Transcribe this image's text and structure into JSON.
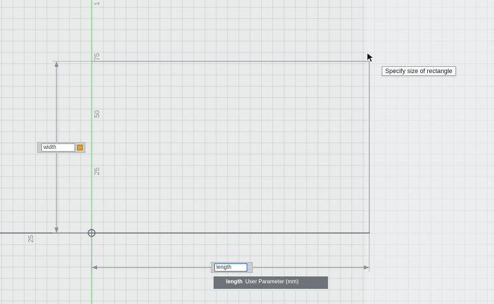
{
  "sketch": {
    "tooltip": "Specify size of rectangle",
    "axis_labels": {
      "y_75": "75",
      "y_50": "50",
      "y_25": "25",
      "x_25": "25",
      "y_top": "1"
    },
    "width_input": {
      "value": "width"
    },
    "length_input": {
      "value": "length"
    },
    "autocomplete": {
      "name": "length",
      "description": "User Parameter (mm)"
    }
  },
  "icons": {
    "lock": "lock-icon",
    "origin": "origin-point-icon",
    "cursor": "mouse-pointer-icon"
  },
  "colors": {
    "canvas_background": "#e9eaea",
    "grid": "#c2c5c8",
    "y_axis": "#7fd97a",
    "sketch_line": "#8d9095",
    "input_focus": "#3d7ad6",
    "lock": "#e0a11b",
    "autocomplete_bg": "#6e7377"
  }
}
